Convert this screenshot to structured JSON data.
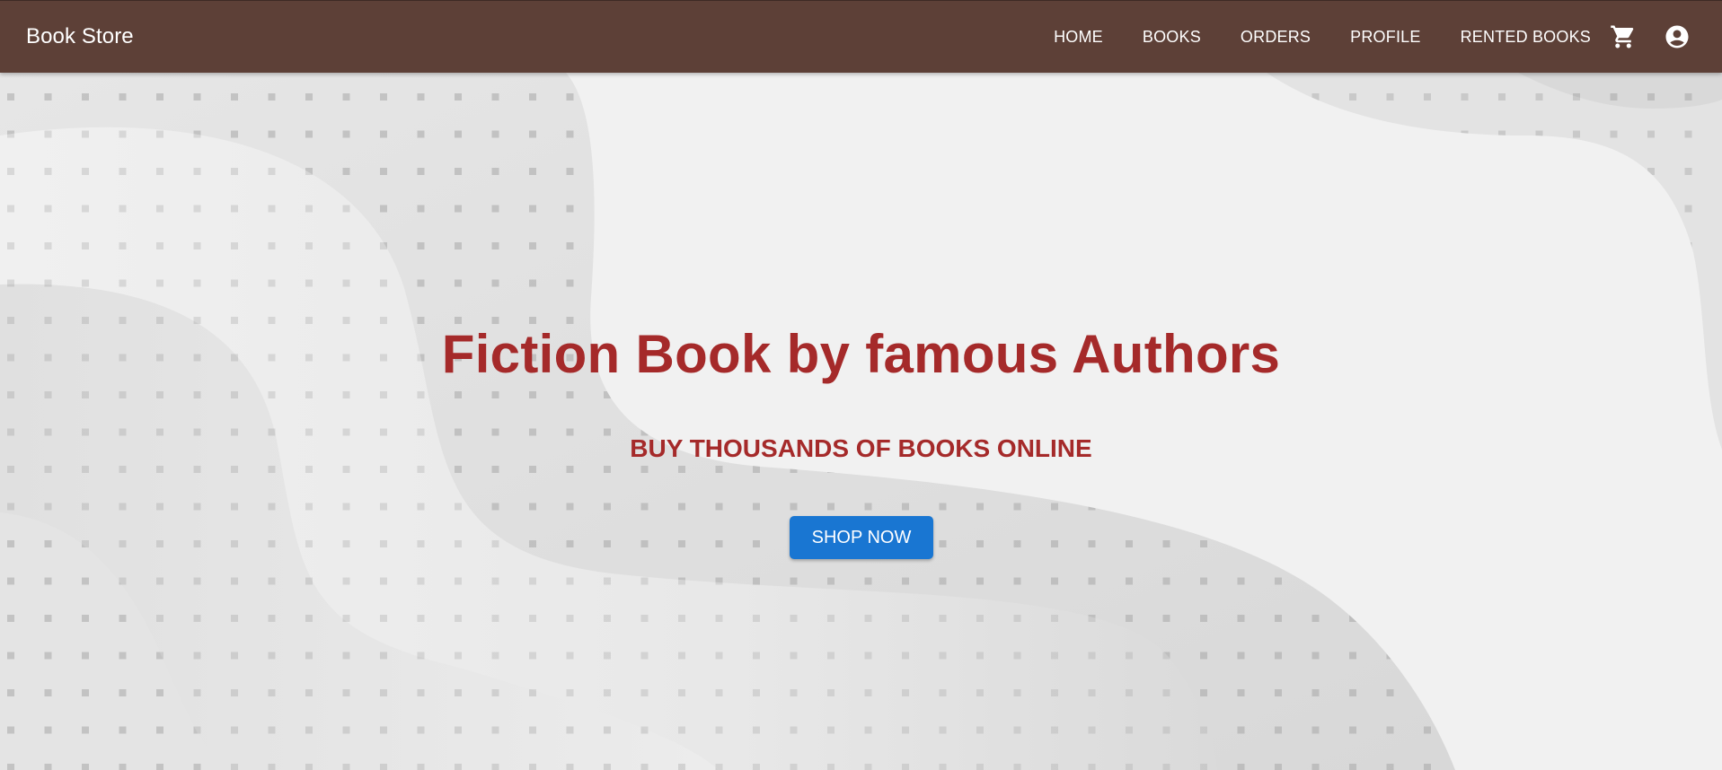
{
  "appbar": {
    "brand": "Book Store",
    "background_color": "#5d4037",
    "nav": [
      {
        "label": "HOME"
      },
      {
        "label": "BOOKS"
      },
      {
        "label": "ORDERS"
      },
      {
        "label": "PROFILE"
      },
      {
        "label": "RENTED BOOKS"
      }
    ],
    "icons": [
      "cart-icon",
      "account-circle-icon"
    ]
  },
  "hero": {
    "title": "Fiction Book by famous Authors",
    "subtitle": "BUY THOUSANDS OF BOOKS ONLINE",
    "button_label": "SHOP NOW",
    "text_color": "#a52a2a",
    "button_color": "#1976d2",
    "background_color": "#f1f1f1"
  }
}
